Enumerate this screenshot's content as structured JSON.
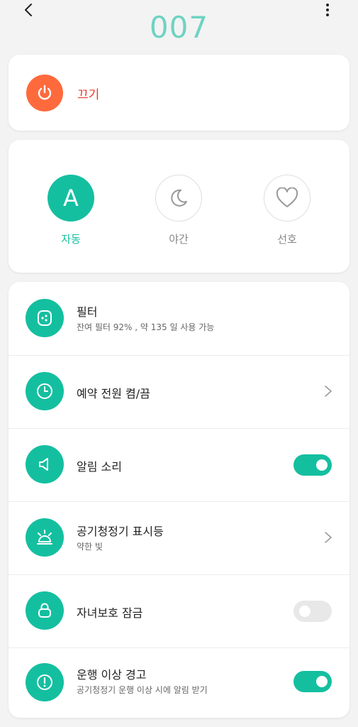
{
  "header": {
    "title": "007",
    "back_icon": "chevron-left-icon",
    "more_icon": "more-vertical-icon"
  },
  "power": {
    "label": "끄기",
    "icon": "power-icon",
    "color": "#ff6a3d"
  },
  "modes": [
    {
      "label": "자동",
      "icon_text": "A",
      "active": true
    },
    {
      "label": "야간",
      "icon": "moon-icon",
      "active": false
    },
    {
      "label": "선호",
      "icon": "heart-icon",
      "active": false
    }
  ],
  "settings": [
    {
      "title": "필터",
      "subtitle": "잔여 필터 92% , 약 135 일 사용 가능",
      "icon": "filter-icon"
    },
    {
      "title": "예약 전원 켬/끔",
      "icon": "clock-icon",
      "control": "chevron"
    },
    {
      "title": "알림 소리",
      "icon": "speaker-icon",
      "control": "toggle",
      "on": true
    },
    {
      "title": "공기청정기 표시등",
      "subtitle": "약한 빛",
      "icon": "light-icon",
      "control": "chevron"
    },
    {
      "title": "자녀보호 잠금",
      "icon": "lock-icon",
      "control": "toggle",
      "on": false
    },
    {
      "title": "운행 이상 경고",
      "subtitle": "공기청정기 운행 이상 시에 알림 받기",
      "icon": "alert-icon",
      "control": "toggle",
      "on": true
    }
  ],
  "colors": {
    "accent": "#14bfa0",
    "power": "#ff6a3d",
    "title": "#6fd3c2"
  }
}
